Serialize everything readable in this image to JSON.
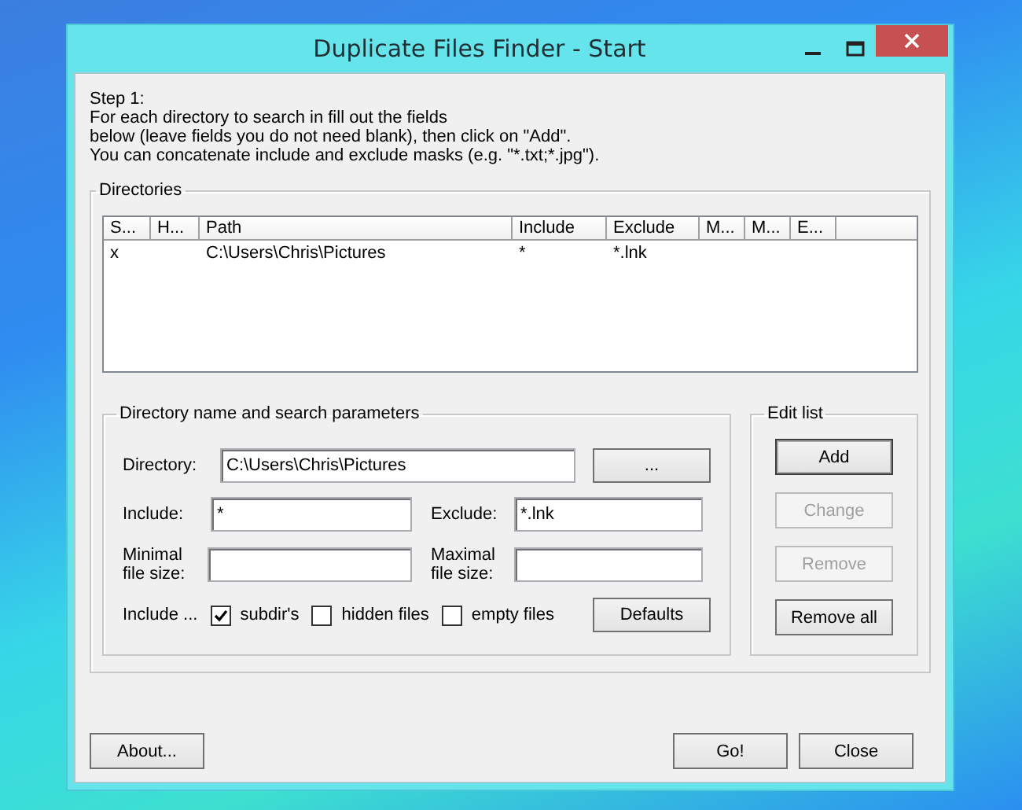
{
  "window": {
    "title": "Duplicate Files Finder - Start"
  },
  "intro": [
    "Step 1:",
    "For each directory to search in fill out the fields",
    "below (leave fields you do not need blank), then click on \"Add\".",
    "You can concatenate include and exclude masks (e.g. \"*.txt;*.jpg\")."
  ],
  "directories": {
    "title": "Directories",
    "columns": [
      "S...",
      "H...",
      "Path",
      "Include",
      "Exclude",
      "M...",
      "M...",
      "E..."
    ],
    "rows": [
      {
        "cells": [
          "x",
          "",
          "C:\\Users\\Chris\\Pictures",
          "*",
          "*.lnk",
          "",
          "",
          ""
        ]
      }
    ]
  },
  "params": {
    "title": "Directory name and search parameters",
    "directory": {
      "label": "Directory:",
      "value": "C:\\Users\\Chris\\Pictures"
    },
    "browse": "...",
    "include": {
      "label": "Include:",
      "value": "*"
    },
    "exclude": {
      "label": "Exclude:",
      "value": "*.lnk"
    },
    "min_size": {
      "label": "Minimal\nfile size:"
    },
    "max_size": {
      "label": "Maximal\nfile size:"
    },
    "include_label": "Include ...",
    "checks": [
      {
        "label": "subdir's",
        "checked": true
      },
      {
        "label": "hidden files",
        "checked": false
      },
      {
        "label": "empty files",
        "checked": false
      }
    ],
    "defaults": "Defaults"
  },
  "edit_list": {
    "title": "Edit list",
    "buttons": [
      {
        "label": "Add",
        "disabled": false,
        "default": true
      },
      {
        "label": "Change",
        "disabled": true,
        "default": false
      },
      {
        "label": "Remove",
        "disabled": true,
        "default": false
      },
      {
        "label": "Remove all",
        "disabled": false,
        "default": false
      }
    ]
  },
  "footer": {
    "about": "About...",
    "go": "Go!",
    "close": "Close"
  }
}
